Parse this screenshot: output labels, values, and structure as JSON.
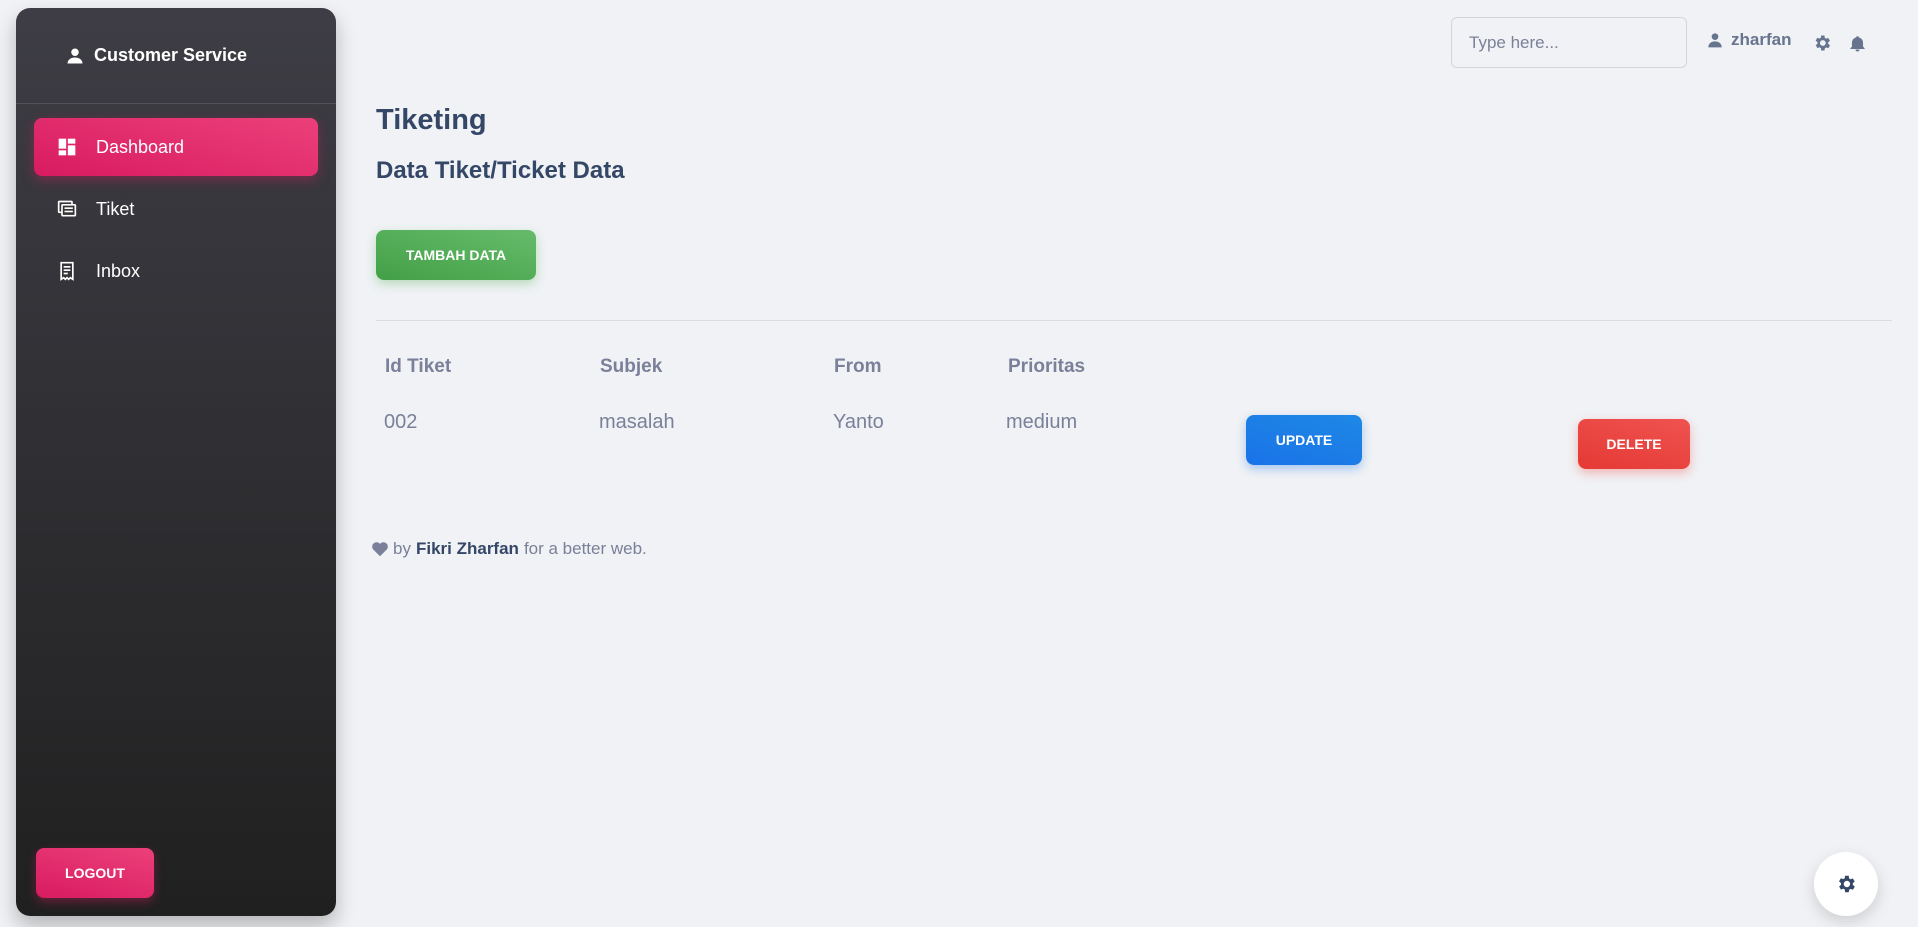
{
  "sidebar": {
    "brand": "Customer Service",
    "items": [
      {
        "label": "Dashboard",
        "icon": "dashboard-icon",
        "active": true
      },
      {
        "label": "Tiket",
        "icon": "ticket-icon",
        "active": false
      },
      {
        "label": "Inbox",
        "icon": "receipt-icon",
        "active": false
      }
    ],
    "logout_label": "LOGOUT"
  },
  "topbar": {
    "search_placeholder": "Type here...",
    "username": "zharfan"
  },
  "main": {
    "title": "Tiketing",
    "section_title": "Data Tiket/Ticket Data",
    "add_button": "TAMBAH DATA",
    "table": {
      "headers": [
        "Id Tiket",
        "Subjek",
        "From",
        "Prioritas"
      ],
      "rows": [
        {
          "id": "002",
          "subject": "masalah",
          "from": "Yanto",
          "priority": "medium",
          "update_label": "UPDATE",
          "delete_label": "DELETE"
        }
      ]
    },
    "footer": {
      "prefix": "by",
      "author": "Fikri Zharfan",
      "suffix": "for a better web."
    }
  },
  "colors": {
    "accent_pink": "#e91e63",
    "success_green": "#4caf50",
    "info_blue": "#1a73e8",
    "danger_red": "#f44335",
    "text_dark": "#344767"
  }
}
